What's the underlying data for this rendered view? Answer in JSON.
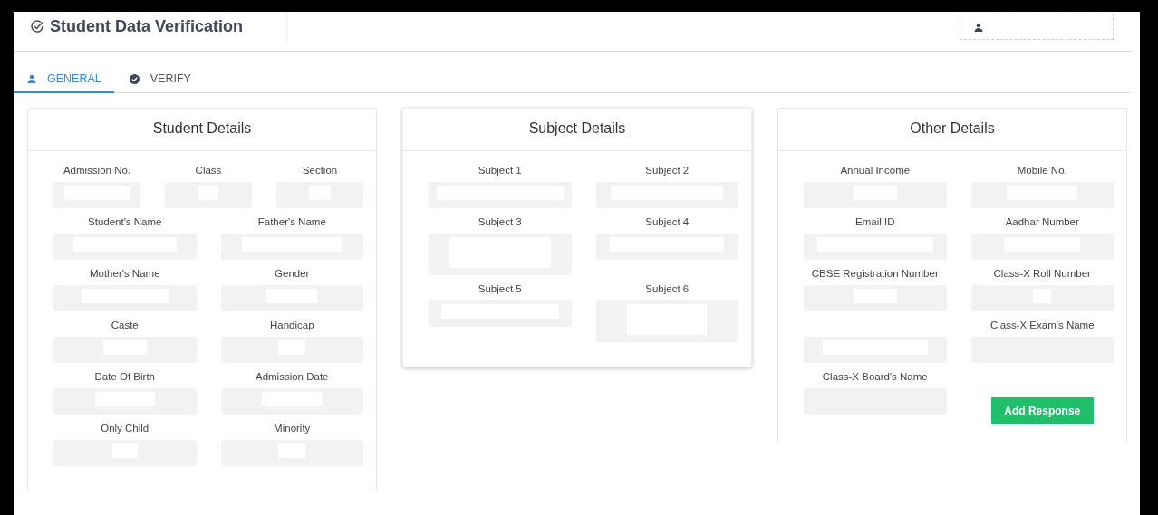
{
  "header": {
    "title": "Student Data Verification"
  },
  "tabs": [
    {
      "label": "GENERAL",
      "kind": "person",
      "selected": true
    },
    {
      "label": "VERIFY",
      "kind": "check",
      "selected": false
    }
  ],
  "cards": [
    {
      "title": "Student Details",
      "raised": false,
      "rows": [
        [
          {
            "label": "Admission No."
          },
          {
            "label": "Class"
          },
          {
            "label": "Section"
          }
        ],
        [
          {
            "label": "Student's Name"
          },
          {
            "label": "Father's Name"
          }
        ],
        [
          {
            "label": "Mother's Name"
          },
          {
            "label": "Gender"
          }
        ],
        [
          {
            "label": "Caste"
          },
          {
            "label": "Handicap"
          }
        ],
        [
          {
            "label": "Date Of Birth"
          },
          {
            "label": "Admission Date"
          }
        ],
        [
          {
            "label": "Only Child"
          },
          {
            "label": "Minority"
          }
        ]
      ]
    },
    {
      "title": "Subject Details",
      "raised": true,
      "rows": [
        [
          {
            "label": "Subject 1",
            "kind": "line"
          },
          {
            "label": "Subject 2",
            "kind": "line"
          }
        ],
        [
          {
            "label": "Subject 3",
            "kind": "tall"
          },
          {
            "label": "Subject 4",
            "kind": "line"
          }
        ],
        [
          {
            "label": "Subject 5",
            "kind": "line"
          },
          {
            "label": "Subject 6",
            "kind": "tall"
          }
        ]
      ]
    },
    {
      "title": "Other Details",
      "raised": false,
      "rows": [
        [
          {
            "label": "Annual Income"
          },
          {
            "label": "Mobile No."
          }
        ],
        [
          {
            "label": "Email ID"
          },
          {
            "label": "Aadhar Number"
          }
        ],
        [
          {
            "label": "CBSE Registration Number"
          },
          {
            "label": "Class-X Roll Number"
          }
        ],
        [
          {},
          {
            "label": "Class-X Exam's Name"
          }
        ],
        [
          {
            "label": "Class-X Board's Name"
          },
          {
            "kind": "button",
            "label": "Add Response"
          }
        ]
      ]
    }
  ]
}
